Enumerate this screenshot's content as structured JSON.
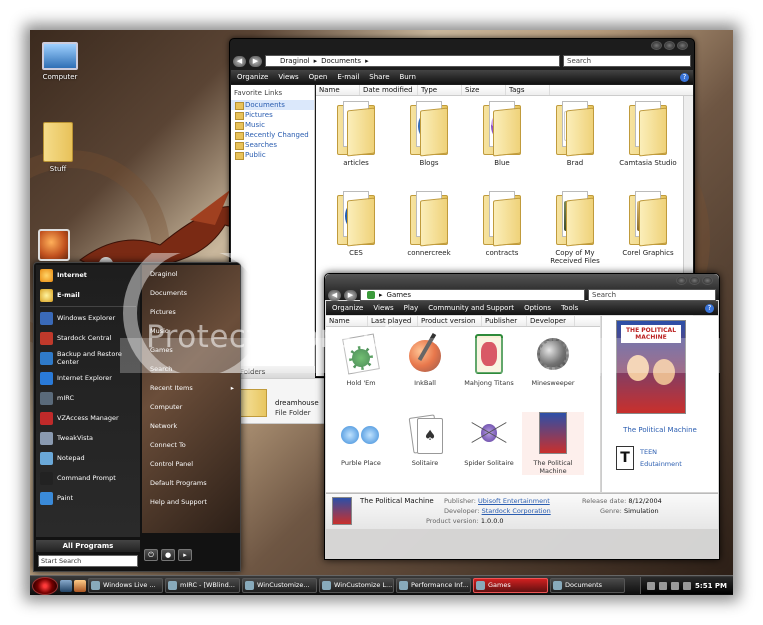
{
  "desktop": {
    "icons": [
      {
        "label": "Computer",
        "icon": "computer-icon"
      },
      {
        "label": "Stuff",
        "icon": "folder-icon"
      }
    ]
  },
  "explorer": {
    "breadcrumb": [
      "Draginol",
      "Documents"
    ],
    "search_placeholder": "Search",
    "toolbar": [
      "Organize",
      "Views",
      "Open",
      "E-mail",
      "Share",
      "Burn"
    ],
    "favorite_links_title": "Favorite Links",
    "favorite_links": [
      "Documents",
      "Pictures",
      "Music",
      "Recently Changed",
      "Searches",
      "Public"
    ],
    "folders_label": "Folders",
    "columns": [
      "Name",
      "Date modified",
      "Type",
      "Size",
      "Tags"
    ],
    "files": [
      {
        "name": "articles",
        "art": "plain"
      },
      {
        "name": "Blogs",
        "art": "blogs"
      },
      {
        "name": "Blue",
        "art": "blue"
      },
      {
        "name": "Brad",
        "art": "brad"
      },
      {
        "name": "Camtasia Studio",
        "art": "plain"
      },
      {
        "name": "CES",
        "art": "ie"
      },
      {
        "name": "connercreek",
        "art": "plain"
      },
      {
        "name": "contracts",
        "art": "plain"
      },
      {
        "name": "Copy of My Received Files",
        "art": "photo"
      },
      {
        "name": "Corel Graphics",
        "art": "corel"
      }
    ],
    "selected_item": {
      "name": "dreamhouse",
      "type": "File Folder"
    }
  },
  "games": {
    "breadcrumb": [
      "Games"
    ],
    "search_placeholder": "Search",
    "toolbar": [
      "Organize",
      "Views",
      "Play",
      "Community and Support",
      "Options",
      "Tools"
    ],
    "columns": [
      "Name",
      "Last played",
      "Product version",
      "Publisher",
      "Developer"
    ],
    "items": [
      {
        "name": "Hold 'Em",
        "art": "chips"
      },
      {
        "name": "InkBall",
        "art": "inkball"
      },
      {
        "name": "Mahjong Titans",
        "art": "mahjong"
      },
      {
        "name": "Minesweeper",
        "art": "mine"
      },
      {
        "name": "Purble Place",
        "art": "purble"
      },
      {
        "name": "Solitaire",
        "art": "cards"
      },
      {
        "name": "Spider Solitaire",
        "art": "spider"
      },
      {
        "name": "The Political Machine",
        "art": "box"
      }
    ],
    "preview": {
      "title": "The Political Machine",
      "box_title": "THE POLITICAL MACHINE",
      "rating": "TEEN",
      "genre_tag": "Edutainment"
    },
    "details": {
      "name": "The Political Machine",
      "publisher_label": "Publisher:",
      "publisher": "Ubisoft Entertainment",
      "developer_label": "Developer:",
      "developer": "Stardock Corporation",
      "version_label": "Product version:",
      "version": "1.0.0.0",
      "release_label": "Release date:",
      "release": "8/12/2004",
      "genre_label": "Genre:",
      "genre": "Simulation"
    }
  },
  "start_menu": {
    "pinned": [
      "Internet",
      "E-mail"
    ],
    "recent": [
      "Windows Explorer",
      "Stardock Central",
      "Backup and Restore Center",
      "Internet Explorer",
      "mIRC",
      "VZAccess Manager",
      "TweakVista",
      "Notepad",
      "Command Prompt",
      "Paint"
    ],
    "all_programs": "All Programs",
    "search_placeholder": "Start Search",
    "right": [
      "Draginol",
      "Documents",
      "Pictures",
      "Music",
      "Games",
      "Search",
      "Recent Items",
      "Computer",
      "Network",
      "Connect To",
      "Control Panel",
      "Default Programs",
      "Help and Support"
    ],
    "right_arrows": [
      false,
      false,
      false,
      false,
      false,
      false,
      true,
      false,
      false,
      false,
      false,
      false,
      false
    ]
  },
  "taskbar": {
    "buttons": [
      {
        "label": "Windows Live ...",
        "active": false
      },
      {
        "label": "mIRC - [WBlind...",
        "active": false
      },
      {
        "label": "WinCustomize...",
        "active": false
      },
      {
        "label": "WinCustomize L...",
        "active": false
      },
      {
        "label": "Performance Inf...",
        "active": false
      },
      {
        "label": "Games",
        "active": true
      },
      {
        "label": "Documents",
        "active": false
      }
    ],
    "clock": "5:51 PM"
  },
  "watermark": {
    "text": "Protect more of"
  },
  "colors": {
    "accent": "#c81e1e",
    "link": "#2a5db0",
    "folder": "#e8c25a"
  }
}
